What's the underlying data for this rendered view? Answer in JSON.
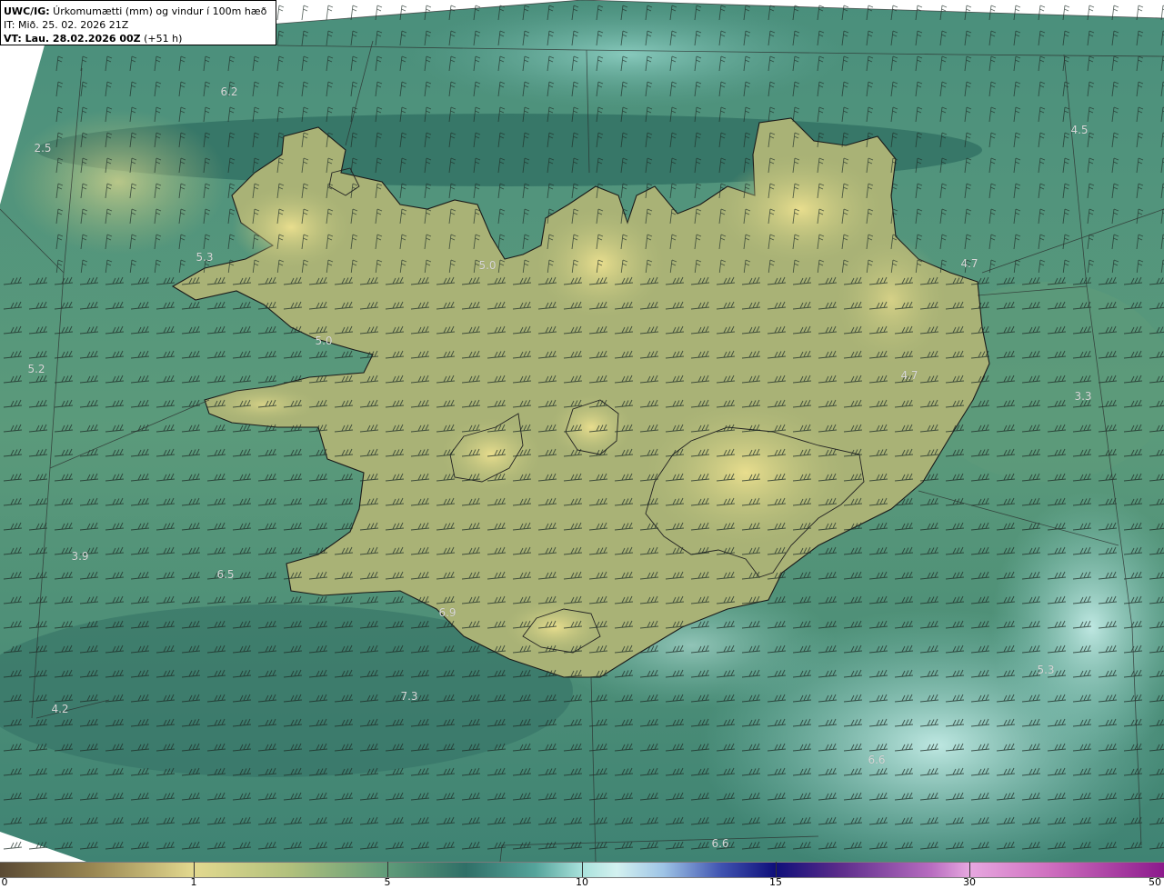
{
  "header": {
    "line1_bold": "UWC/IG:",
    "line1_text": " Úrkomumætti (mm) og vindur í 100m hæð",
    "line2": "IT: Mið. 25. 02. 2026 21Z",
    "line3_bold": "VT: Lau. 28.02.2026 00Z",
    "line3_text": " (+51 h)"
  },
  "value_labels": [
    "6.2",
    "2.5",
    "5.3",
    "5.0",
    "5.0",
    "5.2",
    "3.9",
    "6.5",
    "6.9",
    "7.3",
    "4.2",
    "4.5",
    "4.7",
    "4.7",
    "3.3",
    "5.3",
    "6.6",
    "6.6"
  ],
  "colorbar": {
    "ticks": [
      "0",
      "1",
      "5",
      "10",
      "15",
      "30",
      "50"
    ]
  },
  "colors": {
    "land_dry": "#e3d98f",
    "sea_green": "#3f8a78",
    "light_cyan": "#a9e2dc",
    "coast": "#1a1a1a"
  }
}
